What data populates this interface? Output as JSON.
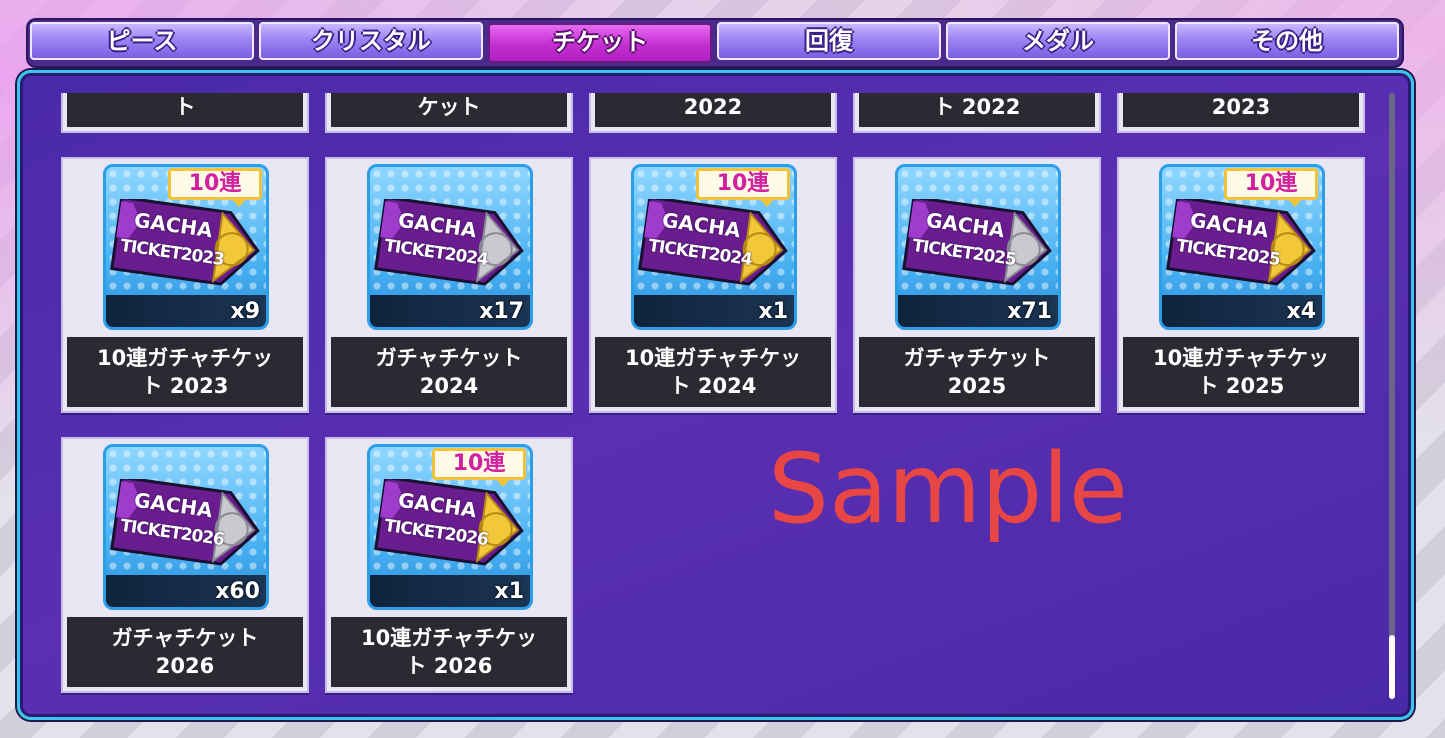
{
  "tabs": [
    "ピース",
    "クリスタル",
    "チケット",
    "回復",
    "メダル",
    "その他"
  ],
  "active_tab": "チケット",
  "top_row": [
    "ト",
    "ケット",
    "2022",
    "ト 2022",
    "2023"
  ],
  "items": [
    {
      "line1": "10連ガチャチケッ",
      "line2": "ト 2023",
      "count": "x9",
      "badge": "10連",
      "ticket_year": "2023"
    },
    {
      "line1": "ガチャチケット",
      "line2": "2024",
      "count": "x17",
      "badge": "",
      "ticket_year": "2024"
    },
    {
      "line1": "10連ガチャチケッ",
      "line2": "ト 2024",
      "count": "x1",
      "badge": "10連",
      "ticket_year": "2024"
    },
    {
      "line1": "ガチャチケット",
      "line2": "2025",
      "count": "x71",
      "badge": "",
      "ticket_year": "2025"
    },
    {
      "line1": "10連ガチャチケッ",
      "line2": "ト 2025",
      "count": "x4",
      "badge": "10連",
      "ticket_year": "2025"
    },
    {
      "line1": "ガチャチケット",
      "line2": "2026",
      "count": "x60",
      "badge": "",
      "ticket_year": "2026"
    },
    {
      "line1": "10連ガチャチケッ",
      "line2": "ト 2026",
      "count": "x1",
      "badge": "10連",
      "ticket_year": "2026"
    }
  ],
  "ticket_text": {
    "gacha": "GACHA",
    "ticket": "TICKET"
  },
  "watermark": "Sample",
  "colors": {
    "panel": "#4a2aa8",
    "active_tab": "#c52fd2",
    "panel_border": "#38c6f0",
    "watermark": "#e84545"
  }
}
